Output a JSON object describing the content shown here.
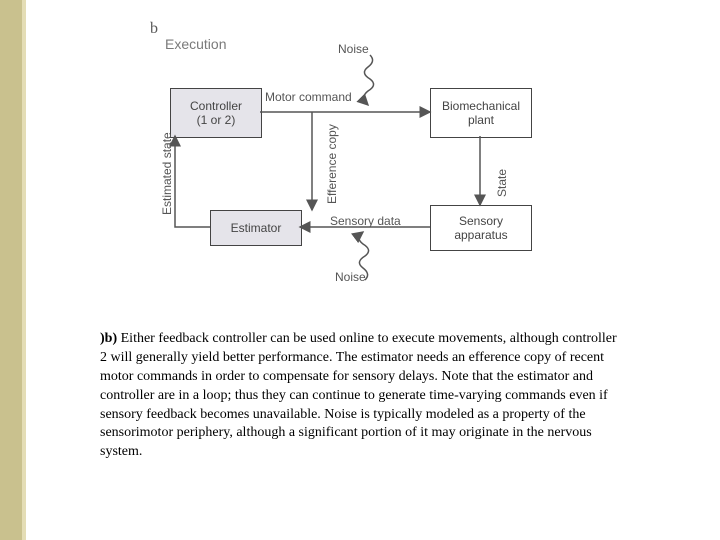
{
  "panel_letter": "b",
  "title": "Execution",
  "boxes": {
    "controller": "Controller\n(1 or 2)",
    "plant": "Biomechanical\nplant",
    "estimator": "Estimator",
    "sensory": "Sensory\napparatus"
  },
  "labels": {
    "noise_top": "Noise",
    "noise_bottom": "Noise",
    "motor_command": "Motor command",
    "efference_copy": "Efference copy",
    "estimated_state": "Estimated state",
    "state": "State",
    "sensory_data": "Sensory data"
  },
  "caption_prefix": ")b) ",
  "caption_body": "Either feedback controller can be used online to execute movements, although controller 2 will generally yield better performance. The estimator needs an efference copy of recent motor commands in order to compensate for sensory delays. Note that the estimator and controller are in a loop; thus they can continue to generate time-varying commands even if sensory feedback becomes unavailable. Noise is typically modeled as a property of the sensorimotor periphery, although a significant portion of it may originate in the nervous system."
}
